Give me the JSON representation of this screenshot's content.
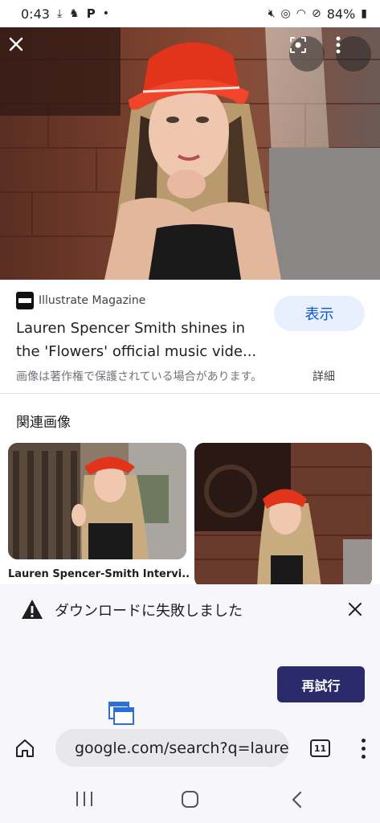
{
  "status_bar": {
    "time": "0:43",
    "battery": "84%",
    "left_icons": [
      "download-done-icon",
      "app-notification-icon",
      "parking-app-icon",
      "dot-icon"
    ],
    "right_icons": [
      "mute-icon",
      "hotspot-icon",
      "wifi-icon",
      "do-not-disturb-icon",
      "battery-icon"
    ]
  },
  "result": {
    "source_name": "Illustrate Magazine",
    "view_button": "表示",
    "title": "Lauren Spencer Smith shines in the 'Flowers' official music vide...",
    "copyright_notice": "画像は著作権で保護されている場合があります。",
    "details_link": "詳細"
  },
  "related": {
    "heading": "関連画像",
    "items": [
      {
        "caption": "Lauren Spencer-Smith Intervi..."
      },
      {
        "caption": ""
      }
    ]
  },
  "download_sheet": {
    "message": "ダウンロードに失敗しました",
    "retry_button": "再試行"
  },
  "browser_toolbar": {
    "url": "google.com/search?q=lauren",
    "tab_count": "11"
  },
  "colors": {
    "view_button_bg": "#e8f0fe",
    "view_button_text": "#0b57d0",
    "retry_button_bg": "#2b2a6b",
    "hat_red": "#e2341b"
  }
}
